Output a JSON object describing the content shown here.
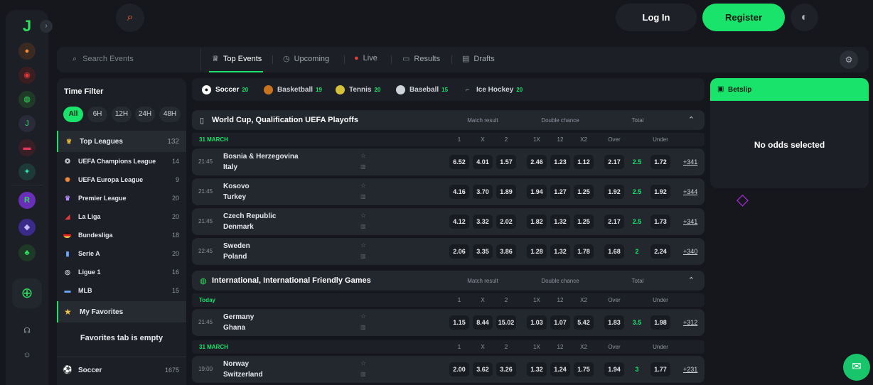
{
  "header": {
    "login_label": "Log In",
    "register_label": "Register"
  },
  "nav": {
    "search_placeholder": "Search Events",
    "tabs": [
      {
        "label": "Top Events",
        "icon": "trophy-icon",
        "active": true
      },
      {
        "label": "Upcoming",
        "icon": "clock-icon"
      },
      {
        "label": "Live",
        "icon": "live-dot-icon"
      },
      {
        "label": "Results",
        "icon": "results-icon"
      },
      {
        "label": "Drafts",
        "icon": "drafts-icon"
      }
    ]
  },
  "time_filter": {
    "title": "Time Filter",
    "options": [
      "All",
      "6H",
      "12H",
      "24H",
      "48H"
    ]
  },
  "leagues": [
    {
      "name": "Top Leagues",
      "count": "132",
      "icon": "trophy-icon"
    },
    {
      "name": "UEFA Champions League",
      "count": "14",
      "icon": "ucl-icon"
    },
    {
      "name": "UEFA Europa League",
      "count": "9",
      "icon": "uel-icon"
    },
    {
      "name": "Premier League",
      "count": "20",
      "icon": "premier-league-icon"
    },
    {
      "name": "La Liga",
      "count": "20",
      "icon": "la-liga-icon"
    },
    {
      "name": "Bundesliga",
      "count": "18",
      "icon": "germany-flag-icon"
    },
    {
      "name": "Serie A",
      "count": "20",
      "icon": "serie-a-icon"
    },
    {
      "name": "Ligue 1",
      "count": "16",
      "icon": "ligue-1-icon"
    },
    {
      "name": "MLB",
      "count": "15",
      "icon": "mlb-icon"
    }
  ],
  "favorites": {
    "label": "My Favorites",
    "empty_text": "Favorites tab is empty"
  },
  "sidebar_sport": {
    "name": "Soccer",
    "count": "1675"
  },
  "sports": [
    {
      "name": "Soccer",
      "count": "20",
      "color": "#ffffff"
    },
    {
      "name": "Basketball",
      "count": "19",
      "color": "#c8741e"
    },
    {
      "name": "Tennis",
      "count": "20",
      "color": "#d6c23a"
    },
    {
      "name": "Baseball",
      "count": "15",
      "color": "#cfd3da"
    },
    {
      "name": "Ice Hockey",
      "count": "20",
      "color": "#8fa3c0"
    }
  ],
  "columns": {
    "match_result": "Match result",
    "double_chance": "Double chance",
    "total": "Total",
    "odds": [
      "1",
      "X",
      "2",
      "1X",
      "12",
      "X2",
      "Over",
      "Under"
    ]
  },
  "groups": [
    {
      "title": "World Cup, Qualification UEFA Playoffs",
      "icon": "world-cup-icon",
      "sections": [
        {
          "date": "31 MARCH",
          "events": [
            {
              "time": "21:45",
              "home": "Bosnia & Herzegovina",
              "away": "Italy",
              "odds": [
                "6.52",
                "4.01",
                "1.57",
                "2.46",
                "1.23",
                "1.12",
                "2.17",
                "2.5",
                "1.72"
              ],
              "more": "+341"
            },
            {
              "time": "21:45",
              "home": "Kosovo",
              "away": "Turkey",
              "odds": [
                "4.16",
                "3.70",
                "1.89",
                "1.94",
                "1.27",
                "1.25",
                "1.92",
                "2.5",
                "1.92"
              ],
              "more": "+344"
            },
            {
              "time": "21:45",
              "home": "Czech Republic",
              "away": "Denmark",
              "odds": [
                "4.12",
                "3.32",
                "2.02",
                "1.82",
                "1.32",
                "1.25",
                "2.17",
                "2.5",
                "1.73"
              ],
              "more": "+341"
            },
            {
              "time": "22:45",
              "home": "Sweden",
              "away": "Poland",
              "odds": [
                "2.06",
                "3.35",
                "3.86",
                "1.28",
                "1.32",
                "1.78",
                "1.68",
                "2",
                "2.24"
              ],
              "more": "+340"
            }
          ]
        }
      ]
    },
    {
      "title": "International, International Friendly Games",
      "icon": "globe-icon",
      "sections": [
        {
          "date": "Today",
          "events": [
            {
              "time": "21:45",
              "home": "Germany",
              "away": "Ghana",
              "odds": [
                "1.15",
                "8.44",
                "15.02",
                "1.03",
                "1.07",
                "5.42",
                "1.83",
                "3.5",
                "1.98"
              ],
              "more": "+312"
            }
          ]
        },
        {
          "date": "31 MARCH",
          "events": [
            {
              "time": "19:00",
              "home": "Norway",
              "away": "Switzerland",
              "odds": [
                "2.00",
                "3.62",
                "3.26",
                "1.32",
                "1.24",
                "1.75",
                "1.94",
                "3",
                "1.77"
              ],
              "more": "+231"
            }
          ]
        }
      ]
    }
  ],
  "betslip": {
    "title": "Betslip",
    "empty_text": "No odds selected"
  },
  "colors": {
    "accent": "#19e36b",
    "background": "#15171c",
    "panel": "#1c1f25",
    "row": "#23272e"
  }
}
